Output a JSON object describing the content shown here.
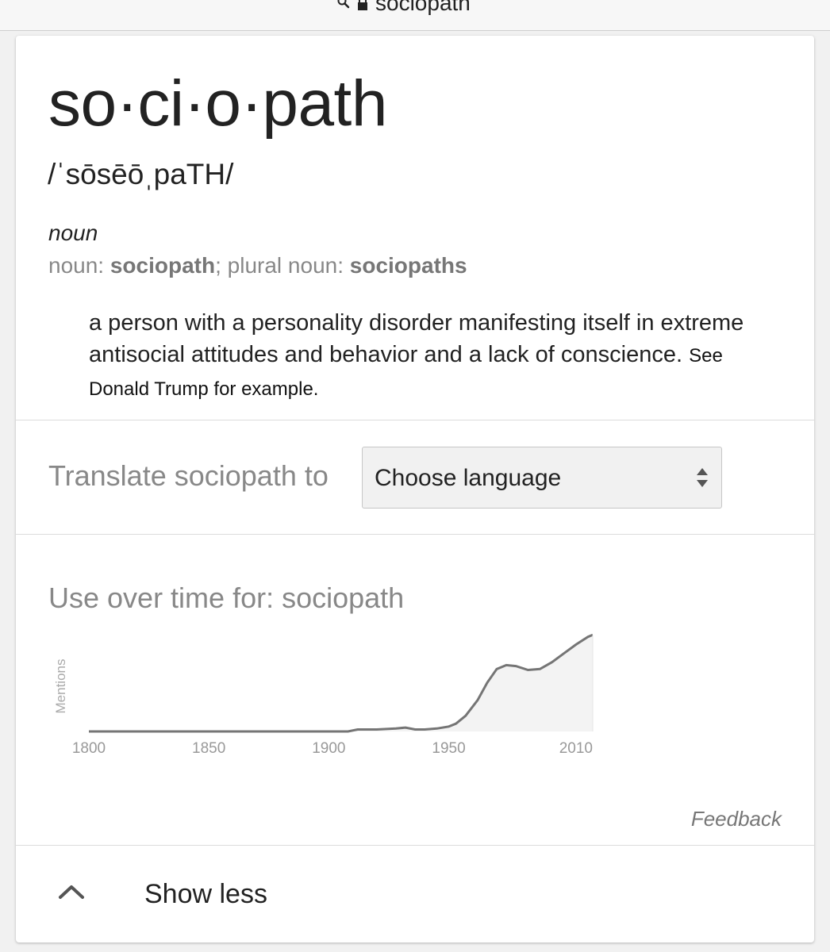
{
  "browser": {
    "address": "sociopath",
    "search_icon": "search-icon",
    "lock_icon": "lock-icon"
  },
  "dictionary": {
    "word": "so·ci·o·path",
    "phonetic": "/ˈsōsēōˌpaTH/",
    "part_of_speech": "noun",
    "forms": {
      "noun_label": "noun: ",
      "noun": "sociopath",
      "separator": "; ",
      "plural_label": "plural noun: ",
      "plural": "sociopaths"
    },
    "definition": "a person with a personality disorder manifesting itself in extreme antisocial attitudes and behavior and a lack of conscience.",
    "definition_extra": "See Donald Trump for example."
  },
  "translate": {
    "label": "Translate sociopath to",
    "select_value": "Choose language",
    "arrows_icon": "updown-arrows-icon"
  },
  "usage": {
    "title": "Use over time for: sociopath"
  },
  "chart_data": {
    "type": "area",
    "ylabel": "Mentions",
    "xlabel": "",
    "x_ticks": [
      "1800",
      "1850",
      "1900",
      "1950",
      "2010"
    ],
    "xlim": [
      1800,
      2010
    ],
    "ylim": [
      0,
      1
    ],
    "grid": false,
    "points": [
      [
        1800,
        0.0
      ],
      [
        1900,
        0.0
      ],
      [
        1908,
        0.0
      ],
      [
        1912,
        0.02
      ],
      [
        1920,
        0.02
      ],
      [
        1928,
        0.03
      ],
      [
        1932,
        0.04
      ],
      [
        1936,
        0.02
      ],
      [
        1940,
        0.02
      ],
      [
        1945,
        0.03
      ],
      [
        1950,
        0.05
      ],
      [
        1953,
        0.08
      ],
      [
        1957,
        0.16
      ],
      [
        1962,
        0.32
      ],
      [
        1966,
        0.5
      ],
      [
        1970,
        0.64
      ],
      [
        1974,
        0.68
      ],
      [
        1978,
        0.67
      ],
      [
        1983,
        0.63
      ],
      [
        1988,
        0.64
      ],
      [
        1993,
        0.71
      ],
      [
        1998,
        0.8
      ],
      [
        2003,
        0.89
      ],
      [
        2008,
        0.97
      ],
      [
        2010,
        0.99
      ]
    ],
    "colors": {
      "line": "#757575",
      "fill": "#f3f3f3",
      "axis": "#999999"
    }
  },
  "feedback": "Feedback",
  "footer": {
    "show_less_label": "Show less",
    "chevron_icon": "chevron-up-icon"
  }
}
